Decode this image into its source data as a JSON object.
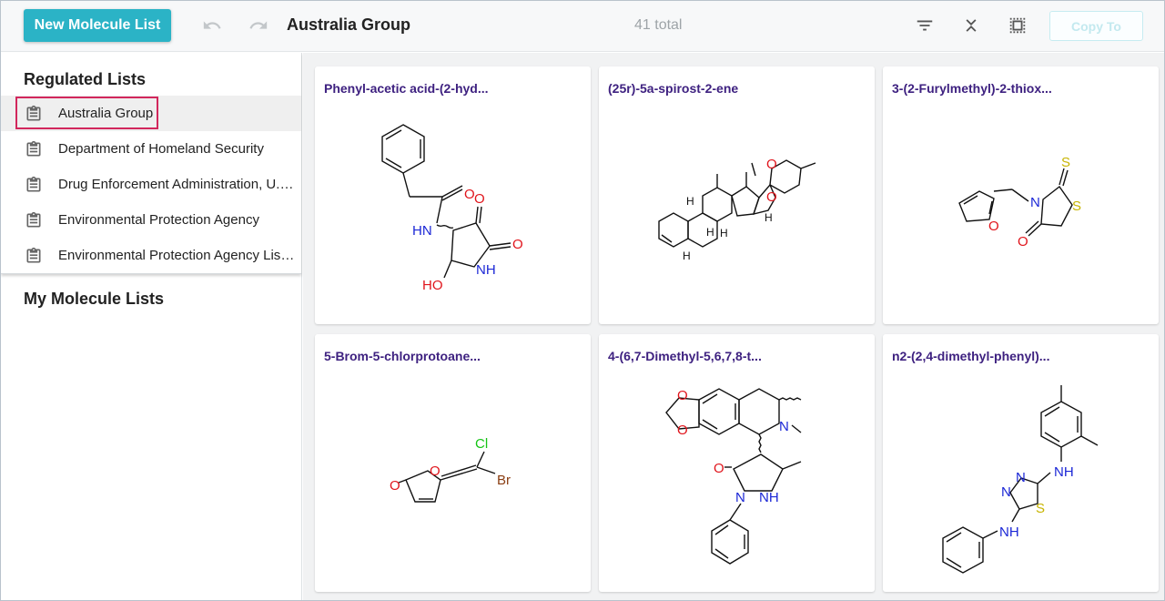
{
  "toolbar": {
    "new_list_label": "New Molecule List",
    "title": "Australia Group",
    "total": "41 total",
    "copy_label": "Copy To"
  },
  "sidebar": {
    "regulated_title": "Regulated Lists",
    "regulated_items": [
      {
        "label": "Australia Group",
        "active": true
      },
      {
        "label": "Department of Homeland Security"
      },
      {
        "label": "Drug Enforcement Administration, U.S..."
      },
      {
        "label": "Environmental Protection Agency"
      },
      {
        "label": "Environmental Protection Agency List..."
      }
    ],
    "my_title": "My Molecule Lists"
  },
  "cards": [
    {
      "title": "Phenyl-acetic acid-(2-hyd..."
    },
    {
      "title": "(25r)-5a-spirost-2-ene"
    },
    {
      "title": "3-(2-Furylmethyl)-2-thiox..."
    },
    {
      "title": "5-Brom-5-chlorprotoane..."
    },
    {
      "title": "4-(6,7-Dimethyl-5,6,7,8-t..."
    },
    {
      "title": "n2-(2,4-dimethyl-phenyl)..."
    }
  ],
  "atom_labels": {
    "o": "O",
    "n": "N",
    "s": "S",
    "h": "H",
    "hn": "HN",
    "nh": "NH",
    "ho": "HO",
    "cl": "Cl",
    "br": "Br"
  },
  "colors": {
    "accent": "#2bb3c6",
    "card_title": "#3e2180",
    "highlight": "#d2275c",
    "oxygen": "#e0141b",
    "nitrogen": "#1b27d6",
    "sulfur": "#c7b400",
    "chlorine": "#15c415",
    "bromine": "#8a3d12"
  },
  "icons": {
    "undo": "undo-icon",
    "redo": "redo-icon",
    "filter": "filter-icon",
    "collapse": "collapse-icon",
    "select": "select-all-icon",
    "list": "clipboard-list-icon"
  }
}
